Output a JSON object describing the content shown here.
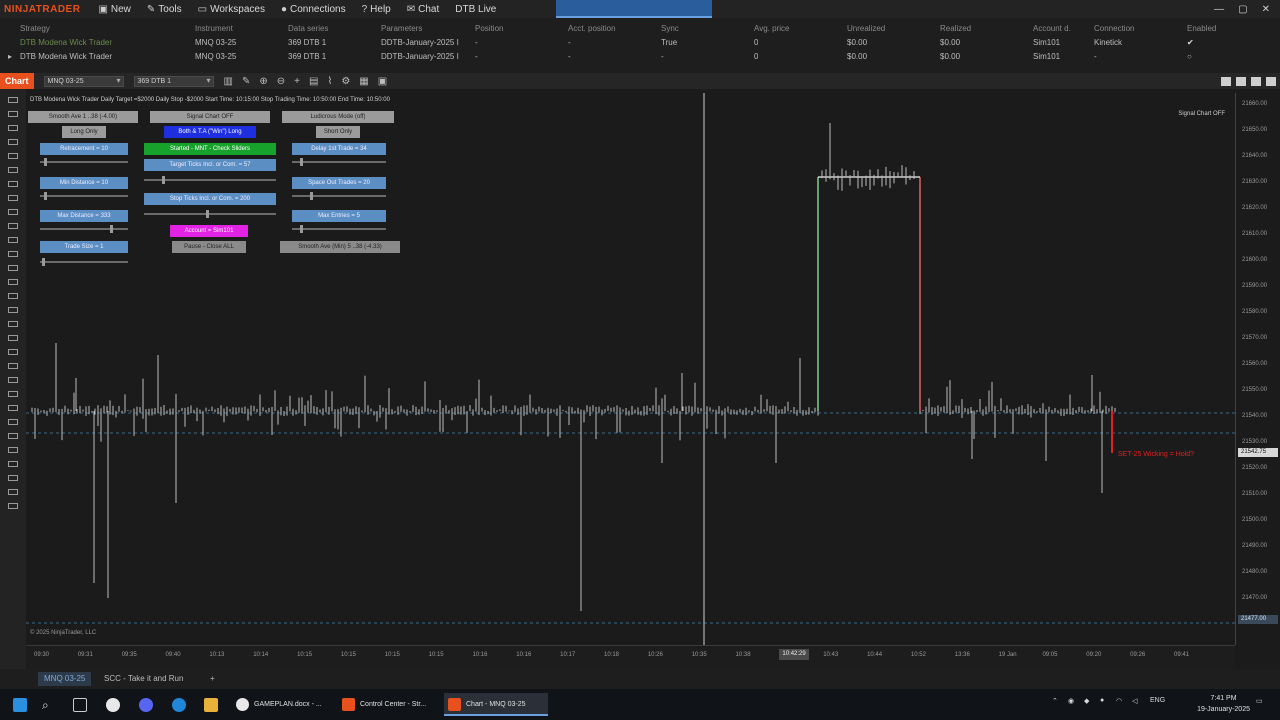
{
  "app": {
    "brand": "NINJATRADER",
    "menu": [
      {
        "label": "New",
        "icon": "new-icon"
      },
      {
        "label": "Tools",
        "icon": "tools-icon"
      },
      {
        "label": "Workspaces",
        "icon": "workspaces-icon"
      },
      {
        "label": "Connections",
        "icon": "connections-icon"
      },
      {
        "label": "Help",
        "icon": "help-icon"
      },
      {
        "label": "Chat",
        "icon": "chat-icon"
      },
      {
        "label": "DTB Live",
        "icon": ""
      }
    ]
  },
  "strategies": {
    "headers": [
      "Strategy",
      "Instrument",
      "Data series",
      "Parameters",
      "Position",
      "Acct. position",
      "Sync",
      "Avg. price",
      "Unrealized",
      "Realized",
      "Account d.",
      "Connection",
      "Enabled"
    ],
    "rows": [
      [
        "DTB Modena Wick Trader",
        "MNQ 03-25",
        "369 DTB 1",
        "DDTB-January-2025 I",
        "-",
        "-",
        "True",
        "0",
        "$0.00",
        "$0.00",
        "Sim101",
        "Kinetick",
        "✔"
      ],
      [
        "DTB Modena Wick Trader",
        "MNQ 03-25",
        "369 DTB 1",
        "DDTB-January-2025 I",
        "-",
        "-",
        "-",
        "0",
        "$0.00",
        "$0.00",
        "Sim101",
        "-",
        "○"
      ]
    ]
  },
  "chart_toolbar": {
    "tab_label": "Chart",
    "instrument": "MNQ 03-25",
    "series": "369 DTB 1"
  },
  "chart": {
    "info_line": "DTB Modena Wick Trader Daily Target =$2000  Daily Stop -$2000  Start Time: 10:15:00  Stop Trading Time: 10:50:00  End Time: 10:50:00",
    "signal_chart": "Signal Chart OFF",
    "copyright": "© 2025 NinjaTrader, LLC",
    "panel": {
      "smooth_ave_1": "Smooth Ave 1 ..38 (-4.00)",
      "signal_chart_off": "Signal Chart OFF",
      "ludicrous_mode": "Ludicrous Mode (off)",
      "long_only": "Long Only",
      "both_long": "Both & T.A (\"Win\") Long",
      "short_only": "Short Only",
      "retracement": "Retracement = 10",
      "started": "Started - MNT - Check Sliders",
      "delay_1st_trade": "Delay 1st Trade = 34",
      "min_distance": "Min Distance = 10",
      "target_ticks": "Target Ticks Incl. or Com. = 57",
      "space_out_trades": "Space Out Trades = 20",
      "max_distance": "Max Distance = 333",
      "stop_ticks": "Stop Ticks Incl. or Com. = 200",
      "max_entries": "Max Entries = 5",
      "account": "Account = Sim101",
      "trade_size": "Trade Size = 1",
      "pause_close": "Pause - Close ALL",
      "smooth_ave_2": "Smooth Ave (Min) 5 ..38 (-4.33)"
    },
    "red_label": "SET-25 Wicking = Hold?",
    "y_labels": [
      "21660.00",
      "21650.00",
      "21640.00",
      "21630.00",
      "21620.00",
      "21610.00",
      "21600.00",
      "21590.00",
      "21580.00",
      "21570.00",
      "21560.00",
      "21550.00",
      "21540.00",
      "21530.00",
      "21520.00",
      "21510.00",
      "21500.00",
      "21490.00",
      "21480.00",
      "21470.00"
    ],
    "current_price": "21542.75",
    "bottom_price": "21477.00",
    "x_labels": [
      "09:30",
      "09:31",
      "09:35",
      "09:40",
      "10:13",
      "10:14",
      "10:15",
      "10:15",
      "10:15",
      "10:15",
      "10:16",
      "10:16",
      "10:17",
      "10:18",
      "10:26",
      "10:35",
      "10:38",
      "10:42:29",
      "10:43",
      "10:44",
      "10:52",
      "13:36",
      "19 Jan",
      "09:05",
      "09:20",
      "09:26",
      "09:41"
    ],
    "x_selected": "10:42:29"
  },
  "bottom_tabs": [
    {
      "label": "MNQ 03-25",
      "active": true
    },
    {
      "label": "SCC - Take it and Run",
      "active": false
    },
    {
      "label": "+",
      "active": false
    }
  ],
  "taskbar": {
    "apps": [
      {
        "label": "GAMEPLAN.docx - ...",
        "icon": "chrome-icon"
      },
      {
        "label": "Control Center - Str...",
        "icon": "ninjatrader-icon"
      },
      {
        "label": "Chart - MNQ 03-25",
        "icon": "ninjatrader-icon"
      }
    ],
    "lang": "ENG",
    "time": "7:41 PM",
    "date": "19-January-2025"
  }
}
